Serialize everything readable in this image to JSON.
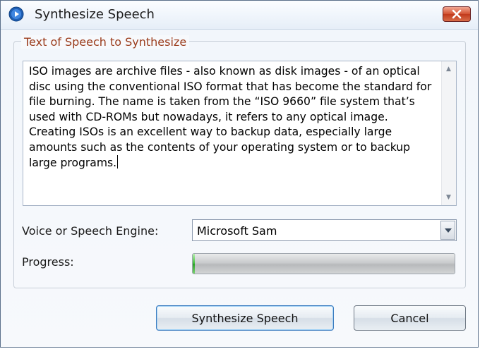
{
  "window": {
    "title": "Synthesize Speech",
    "icon": "media-play-icon",
    "close_icon": "close-icon"
  },
  "group": {
    "legend": "Text of Speech to Synthesize",
    "text": "ISO images are archive files - also known as disk images - of an optical disc using the conventional ISO format that has become the standard for file burning. The name is taken from the “ISO 9660” file system that’s used with CD-ROMs but nowadays, it refers to any optical image. Creating ISOs is an excellent way to backup data, especially large amounts such as the contents of your operating system or to backup large programs."
  },
  "voice": {
    "label": "Voice or Speech Engine:",
    "selected": "Microsoft Sam"
  },
  "progress": {
    "label": "Progress:",
    "value_fraction": 0.005
  },
  "buttons": {
    "synthesize": "Synthesize Speech",
    "cancel": "Cancel"
  },
  "colors": {
    "legend": "#9a3b1b",
    "close": "#d2512f",
    "progress_fill": "#3fbd3a"
  }
}
